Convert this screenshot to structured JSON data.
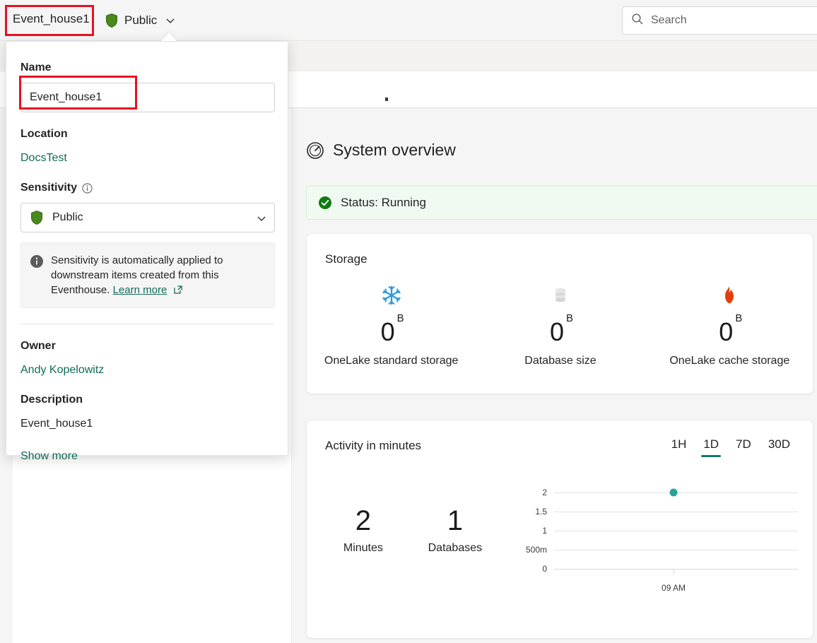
{
  "header": {
    "item_name": "Event_house1",
    "sensitivity_label": "Public",
    "shield_icon": "shield-icon",
    "chevron_icon": "chevron-down-icon"
  },
  "search": {
    "placeholder": "Search",
    "icon": "search-icon"
  },
  "details_panel": {
    "name_label": "Name",
    "name_value": "Event_house1",
    "location_label": "Location",
    "location_value": "DocsTest",
    "sensitivity_label": "Sensitivity",
    "sensitivity_info_icon": "info-icon",
    "sensitivity_value": "Public",
    "sensitivity_shield_icon": "shield-icon",
    "sensitivity_chevron_icon": "chevron-down-icon",
    "note_icon": "info-icon",
    "note_text": "Sensitivity is automatically applied to downstream items created from this Eventhouse.",
    "note_link": "Learn more",
    "note_link_icon": "external-link-icon",
    "owner_label": "Owner",
    "owner_value": "Andy Kopelowitz",
    "description_label": "Description",
    "description_value": "Event_house1",
    "show_more": "Show more"
  },
  "system_overview": {
    "title": "System overview",
    "icon": "gauge-icon",
    "status_icon": "check-circle-icon",
    "status_text": "Status: Running"
  },
  "storage_card": {
    "title": "Storage",
    "metrics": [
      {
        "icon": "snowflake-icon",
        "value": "0",
        "unit": "B",
        "caption": "OneLake standard storage",
        "color": "#2e9bd6"
      },
      {
        "icon": "database-icon",
        "value": "0",
        "unit": "B",
        "caption": "Database size",
        "color": "#e1e1e1"
      },
      {
        "icon": "flame-icon",
        "value": "0",
        "unit": "B",
        "caption": "OneLake cache storage",
        "color": "#e33d0a"
      }
    ]
  },
  "activity_card": {
    "title": "Activity in minutes",
    "range_tabs": [
      {
        "label": "1H",
        "selected": false
      },
      {
        "label": "1D",
        "selected": true
      },
      {
        "label": "7D",
        "selected": false
      },
      {
        "label": "30D",
        "selected": false
      }
    ],
    "summary": [
      {
        "value": "2",
        "caption": "Minutes"
      },
      {
        "value": "1",
        "caption": "Databases"
      }
    ]
  },
  "chart_data": {
    "type": "scatter",
    "title": "Activity in minutes",
    "xlabel": "",
    "ylabel": "",
    "ylim": [
      0,
      2
    ],
    "ytick_labels": [
      "0",
      "500m",
      "1",
      "1.5",
      "2"
    ],
    "ytick_values": [
      0,
      0.5,
      1,
      1.5,
      2
    ],
    "xtick_labels": [
      "09 AM"
    ],
    "grid": true,
    "legend": "none",
    "point_color": "#2aa096",
    "series": [
      {
        "name": "Minutes",
        "x": [
          "09 AM"
        ],
        "values": [
          2
        ]
      }
    ]
  },
  "highlights": {
    "title_box": "Event_house1",
    "name_field_box": "Event_house1",
    "color": "#e81123"
  }
}
